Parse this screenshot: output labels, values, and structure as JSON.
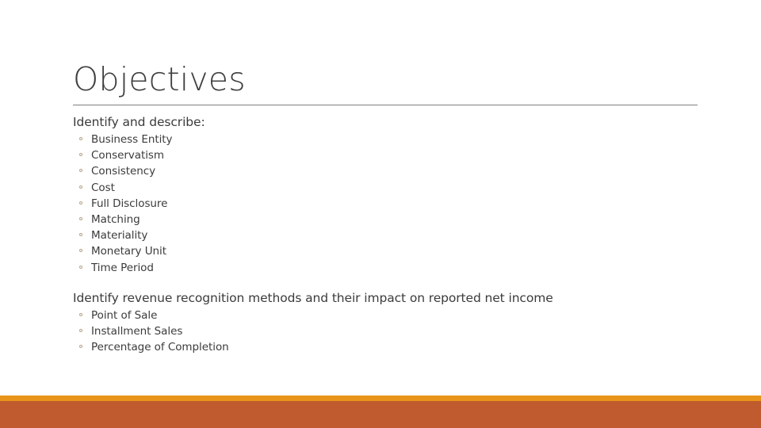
{
  "slide": {
    "title": "Objectives",
    "groups": [
      {
        "heading": "Identify and describe:",
        "items": [
          "Business Entity",
          "Conservatism",
          "Consistency",
          "Cost",
          "Full Disclosure",
          "Matching",
          "Materiality",
          "Monetary Unit",
          "Time Period"
        ]
      },
      {
        "heading": "Identify revenue recognition methods and their impact on reported net income",
        "items": [
          "Point of Sale",
          "Installment Sales",
          "Percentage of Completion"
        ]
      }
    ]
  },
  "theme": {
    "title_color": "#404040",
    "body_color": "#3b3b3b",
    "rule_color": "#7f7f7f",
    "bullet_color": "#b7a68b",
    "accent_amber": "#e8941a",
    "accent_brick": "#bf5b2e",
    "background": "#ffffff"
  }
}
